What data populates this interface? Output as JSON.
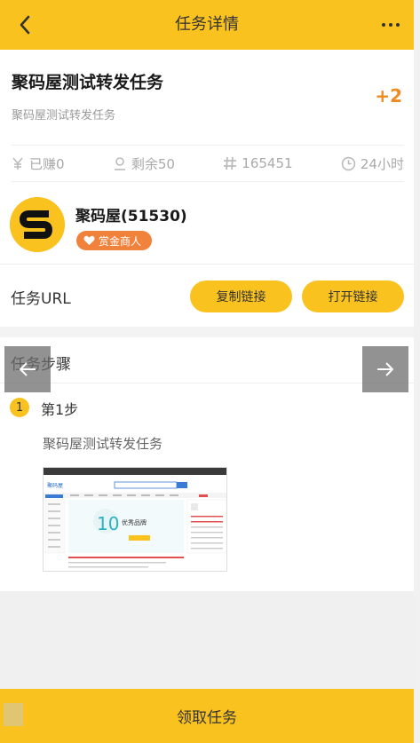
{
  "header": {
    "title": "任务详情",
    "back_icon": "chevron-left-icon",
    "more_icon": "more-horizontal-icon"
  },
  "task": {
    "title": "聚码屋测试转发任务",
    "subtitle": "聚码屋测试转发任务",
    "reward": "+2"
  },
  "stats": [
    {
      "icon": "yen-icon",
      "text": "已赚0"
    },
    {
      "icon": "user-icon",
      "text": "剩余50"
    },
    {
      "icon": "hash-icon",
      "text": "165451"
    },
    {
      "icon": "clock-icon",
      "text": "24小时"
    }
  ],
  "merchant": {
    "name": "聚码屋(51530)",
    "badge": "赏金商人",
    "avatar_letter": "S"
  },
  "url": {
    "label": "任务URL",
    "copy_label": "复制链接",
    "open_label": "打开链接"
  },
  "steps": {
    "title": "任务步骤",
    "items": [
      {
        "number": "1",
        "label": "第1步",
        "description": "聚码屋测试转发任务"
      }
    ],
    "screenshot_logo": "聚码屋",
    "screenshot_banner": "优秀品牌",
    "screenshot_banner_number": "10"
  },
  "footer": {
    "claim_label": "领取任务"
  },
  "colors": {
    "accent": "#f9c21f",
    "reward": "#f08a1e",
    "badge": "#f1823c"
  }
}
